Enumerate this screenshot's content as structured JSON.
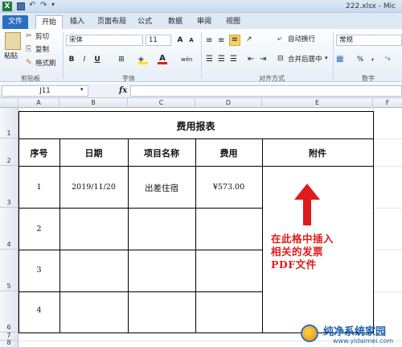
{
  "window": {
    "filename": "222.xlsx",
    "app_title": "222.xlsx - Mic"
  },
  "tabs": [
    "文件",
    "开始",
    "插入",
    "页面布局",
    "公式",
    "数据",
    "审阅",
    "视图"
  ],
  "ribbon": {
    "clipboard": {
      "paste": "粘贴",
      "cut": "剪切",
      "copy": "复制",
      "format_painter": "格式刷",
      "group": "剪贴板"
    },
    "font": {
      "name": "宋体",
      "size": "11",
      "grow": "A",
      "shrink": "A",
      "bold": "B",
      "italic": "I",
      "underline": "U",
      "wen": "wén",
      "group": "字体"
    },
    "alignment": {
      "wrap": "自动换行",
      "merge": "合并后居中",
      "group": "对齐方式"
    },
    "number": {
      "format": "常规",
      "percent": "%",
      "comma": ",",
      "group": "数字"
    }
  },
  "formula_bar": {
    "name_box": "J11",
    "fx": "fx",
    "value": ""
  },
  "columns": [
    "A",
    "B",
    "C",
    "D",
    "E",
    "F"
  ],
  "rows": [
    "1",
    "2",
    "3",
    "4",
    "5",
    "6",
    "7",
    "8"
  ],
  "sheet": {
    "title": "费用报表",
    "headers": [
      "序号",
      "日期",
      "项目名称",
      "费用",
      "附件"
    ],
    "records": [
      {
        "no": "1",
        "date": "2019/11/20",
        "item": "出差住宿",
        "cost": "¥573.00"
      },
      {
        "no": "2",
        "date": "",
        "item": "",
        "cost": ""
      },
      {
        "no": "3",
        "date": "",
        "item": "",
        "cost": ""
      },
      {
        "no": "4",
        "date": "",
        "item": "",
        "cost": ""
      }
    ]
  },
  "annotation": {
    "line1": "在此格中插入",
    "line2": "相关的发票",
    "line3": "PDF文件",
    "color": "#e01b1b"
  },
  "watermark": {
    "title": "纯净系统家园",
    "url": "www.yidaimei.com"
  },
  "colors": {
    "accent": "#2a6fc0",
    "ribbon_bg": "#dfe9f5"
  }
}
